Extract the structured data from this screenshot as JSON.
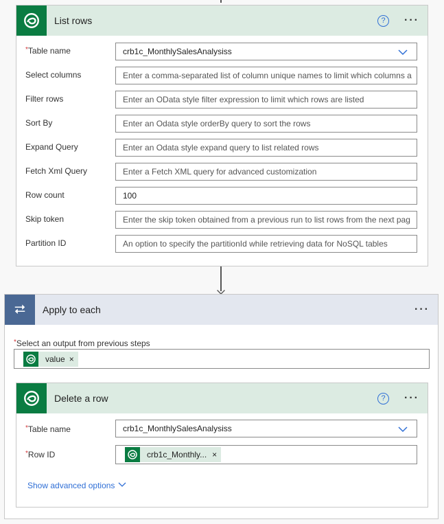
{
  "list_rows": {
    "title": "List rows",
    "fields": [
      {
        "label": "Table name",
        "required": true,
        "value": "crb1c_MonthlySalesAnalysiss"
      },
      {
        "label": "Select columns",
        "placeholder": "Enter a comma-separated list of column unique names to limit which columns a"
      },
      {
        "label": "Filter rows",
        "placeholder": "Enter an OData style filter expression to limit which rows are listed"
      },
      {
        "label": "Sort By",
        "placeholder": "Enter an Odata style orderBy query to sort the rows"
      },
      {
        "label": "Expand Query",
        "placeholder": "Enter an Odata style expand query to list related rows"
      },
      {
        "label": "Fetch Xml Query",
        "placeholder": "Enter a Fetch XML query for advanced customization"
      },
      {
        "label": "Row count",
        "value": "100"
      },
      {
        "label": "Skip token",
        "placeholder": "Enter the skip token obtained from a previous run to list rows from the next pag"
      },
      {
        "label": "Partition ID",
        "placeholder": "An option to specify the partitionId while retrieving data for NoSQL tables"
      }
    ]
  },
  "apply": {
    "title": "Apply to each",
    "select_label": "Select an output from previous steps",
    "token": "value"
  },
  "delete_row": {
    "title": "Delete a row",
    "table_label": "Table name",
    "table_value": "crb1c_MonthlySalesAnalysiss",
    "row_label": "Row ID",
    "row_token": "crb1c_Monthly...",
    "advanced": "Show advanced options"
  },
  "icons": {
    "help": "?",
    "more": "···",
    "required": "*",
    "remove": "×"
  },
  "colors": {
    "dataverse": "#0a7c42",
    "loop": "#4a6894",
    "link": "#2f6fd6"
  }
}
